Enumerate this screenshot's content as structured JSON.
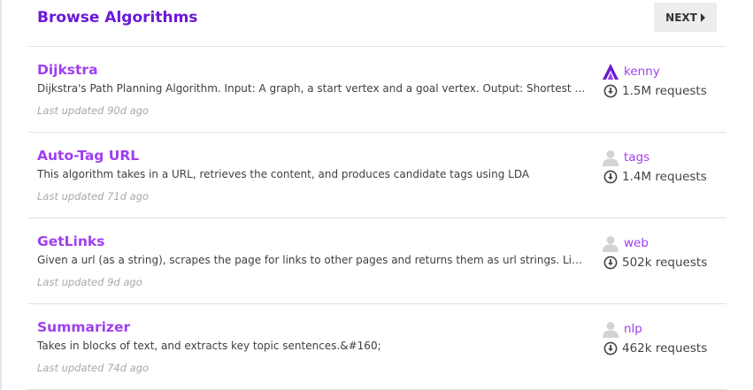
{
  "header": {
    "title": "Browse Algorithms",
    "next_label": "NEXT"
  },
  "colors": {
    "title": "#6b18d6",
    "link": "#a03ef2",
    "button_bg": "#ededed",
    "divider": "#e2e2e2"
  },
  "items": [
    {
      "name": "Dijkstra",
      "description": "Dijkstra's Path Planning Algorithm. Input: A graph, a start vertex and a goal vertex. Output: Shortest path between start and goal",
      "updated": "Last updated 90d ago",
      "owner": "kenny",
      "owner_icon": "algorithmia-logo-icon",
      "requests": "1.5M requests"
    },
    {
      "name": "Auto-Tag URL",
      "description": "This algorithm takes in a URL, retrieves the content, and produces candidate tags using LDA",
      "updated": "Last updated 71d ago",
      "owner": "tags",
      "owner_icon": "user-avatar-icon",
      "requests": "1.4M requests"
    },
    {
      "name": "GetLinks",
      "description": "Given a url (as a string), scrapes the page for links to other pages and returns them as url strings. Links",
      "updated": "Last updated 9d ago",
      "owner": "web",
      "owner_icon": "user-avatar-icon",
      "requests": "502k requests"
    },
    {
      "name": "Summarizer",
      "description": "Takes in blocks of text, and extracts key topic sentences.&#160;",
      "updated": "Last updated 74d ago",
      "owner": "nlp",
      "owner_icon": "user-avatar-icon",
      "requests": "462k requests"
    }
  ]
}
